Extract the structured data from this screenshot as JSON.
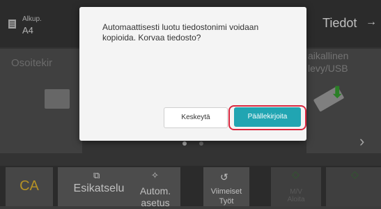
{
  "header": {
    "original_label": "Alkup.",
    "original_value": "A4",
    "info_button": "Tiedot",
    "info_arrow": "→"
  },
  "tiles": {
    "left_label": "Osoitekir",
    "right_label_line1": "aikallinen",
    "right_label_line2": "levy/USB"
  },
  "pager": {
    "active_index": 0,
    "count": 2,
    "next_arrow": "›"
  },
  "bottom": {
    "ca": "CA",
    "preview": "Esikatselu",
    "auto_line1": "Autom.",
    "auto_line2": "asetus",
    "jobs_line1": "Viimeiset",
    "jobs_line2": "Työt",
    "bw_line1": "M/V",
    "bw_line2": "Aloita"
  },
  "dialog": {
    "message": "Automaattisesti luotu tiedostonimi voidaan kopioida. Korvaa tiedosto?",
    "cancel_label": "Keskeytä",
    "overwrite_label": "Päällekirjoita"
  },
  "colors": {
    "accent": "#21a5b2",
    "highlight_ring": "#d9263e",
    "ca_text": "#f1c232",
    "start_green": "#3d7a3a"
  }
}
